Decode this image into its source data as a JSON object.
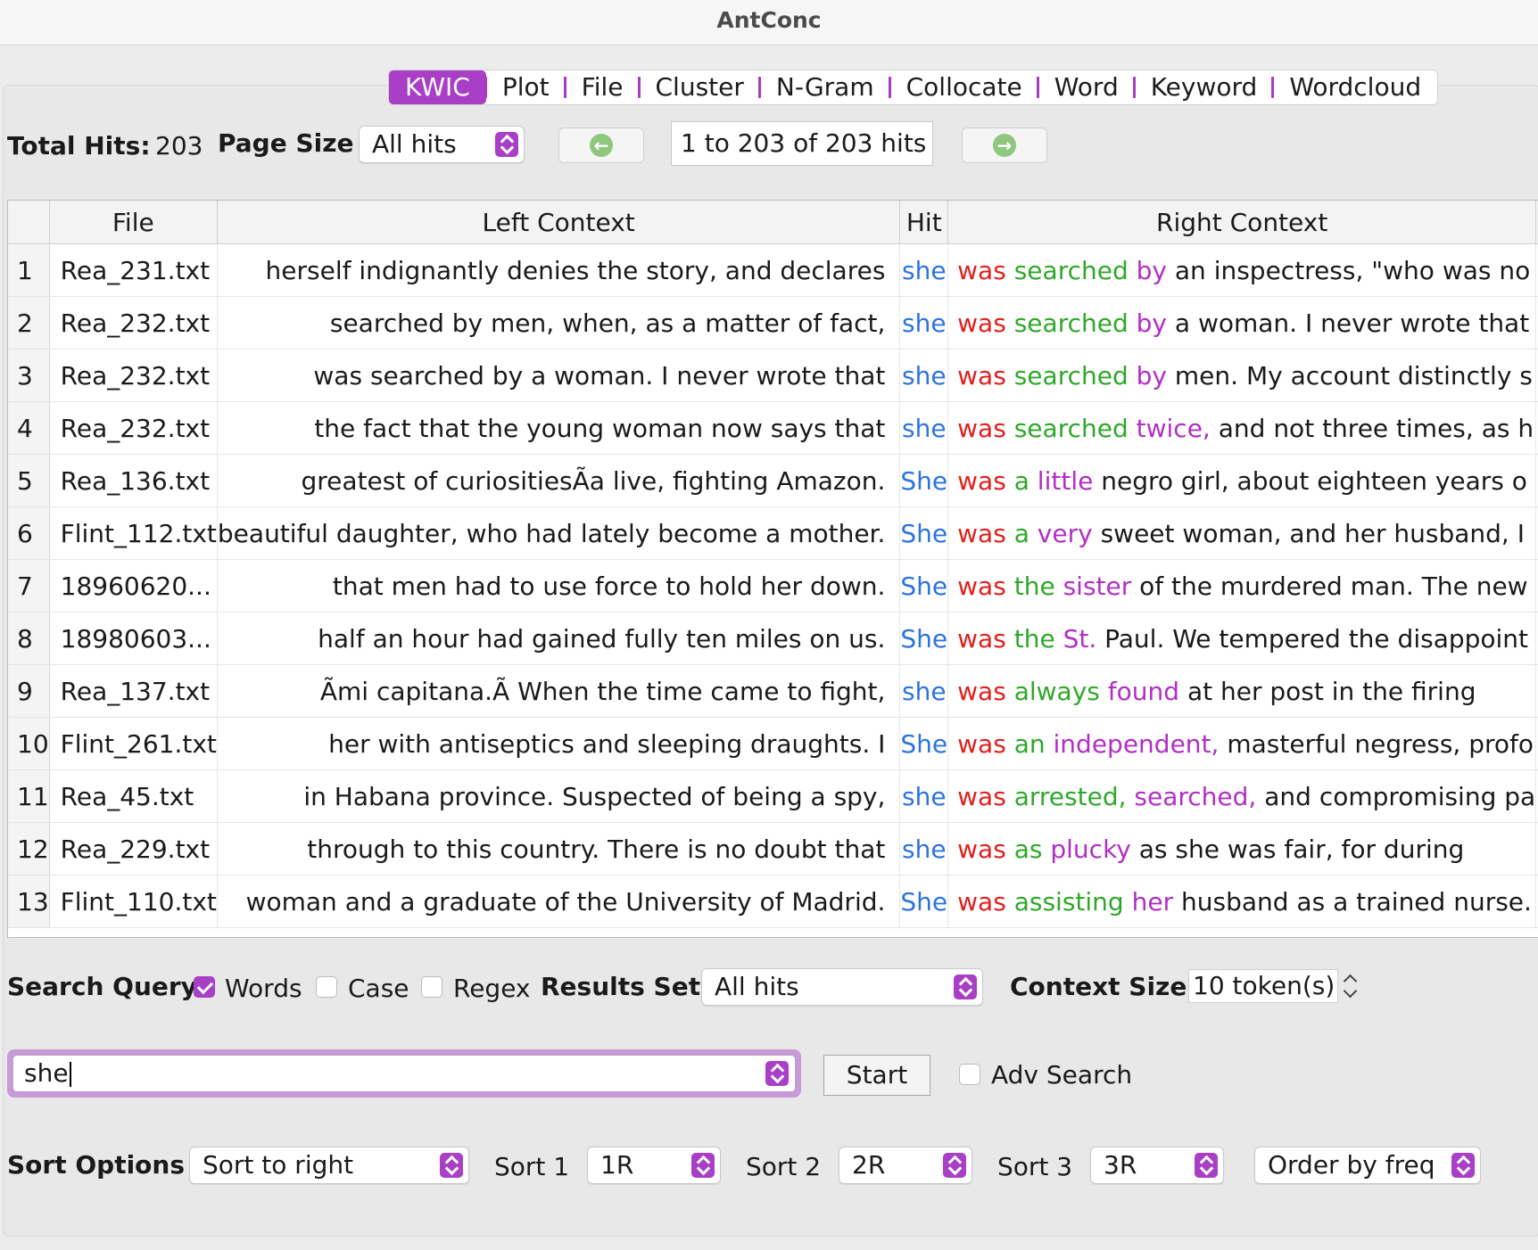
{
  "window": {
    "title": "AntConc"
  },
  "tabs": [
    {
      "label": "KWIC",
      "active": true
    },
    {
      "label": "Plot"
    },
    {
      "label": "File"
    },
    {
      "label": "Cluster"
    },
    {
      "label": "N-Gram"
    },
    {
      "label": "Collocate"
    },
    {
      "label": "Word"
    },
    {
      "label": "Keyword"
    },
    {
      "label": "Wordcloud"
    }
  ],
  "toolbar": {
    "total_hits_label": "Total Hits:",
    "total_hits_value": "203",
    "page_size_label": "Page Size",
    "page_size_value": "All hits",
    "prev_icon": "arrow-left-circle-icon",
    "next_icon": "arrow-right-circle-icon",
    "page_range": "1 to 203 of 203 hits"
  },
  "table": {
    "columns": [
      "",
      "File",
      "Left Context",
      "Hit",
      "Right Context"
    ],
    "rows": [
      {
        "n": "1",
        "file": "Rea_231.txt",
        "left": "herself indignantly denies the story, and declares",
        "hit": "she",
        "r1": "was",
        "r2": "searched",
        "r3": "by",
        "rest": "an inspectress, \"who was no"
      },
      {
        "n": "2",
        "file": "Rea_232.txt",
        "left": "searched by men, when, as a matter of fact,",
        "hit": "she",
        "r1": "was",
        "r2": "searched",
        "r3": "by",
        "rest": "a woman. I never wrote that"
      },
      {
        "n": "3",
        "file": "Rea_232.txt",
        "left": "was searched by a woman. I never wrote that",
        "hit": "she",
        "r1": "was",
        "r2": "searched",
        "r3": "by",
        "rest": "men. My account distinctly s"
      },
      {
        "n": "4",
        "file": "Rea_232.txt",
        "left": "the fact that the young woman now says that",
        "hit": "she",
        "r1": "was",
        "r2": "searched",
        "r3": "twice,",
        "rest": "and not three times, as h"
      },
      {
        "n": "5",
        "file": "Rea_136.txt",
        "left": "greatest of curiositiesÃa live, fighting Amazon.",
        "hit": "She",
        "r1": "was",
        "r2": "a",
        "r3": "little",
        "rest": "negro girl, about eighteen years o"
      },
      {
        "n": "6",
        "file": "Flint_112.txt",
        "left": "beautiful daughter, who had lately become a mother.",
        "hit": "She",
        "r1": "was",
        "r2": "a",
        "r3": "very",
        "rest": "sweet woman, and her husband, I"
      },
      {
        "n": "7",
        "file": "18960620...",
        "left": "that men had to use force to hold her down.",
        "hit": "She",
        "r1": "was",
        "r2": "the",
        "r3": "sister",
        "rest": "of the murdered man. The new"
      },
      {
        "n": "8",
        "file": "18980603...",
        "left": "half an hour had gained fully ten miles on us.",
        "hit": "She",
        "r1": "was",
        "r2": "the",
        "r3": "St.",
        "rest": "Paul. We tempered the disappoint"
      },
      {
        "n": "9",
        "file": "Rea_137.txt",
        "left": "Ãmi capitana.Ã When the time came to fight,",
        "hit": "she",
        "r1": "was",
        "r2": "always",
        "r3": "found",
        "rest": "at her post in the firing"
      },
      {
        "n": "10",
        "file": "Flint_261.txt",
        "left": "her with antiseptics and sleeping draughts. I",
        "hit": "She",
        "r1": "was",
        "r2": "an",
        "r3": "independent,",
        "rest": "masterful negress, profo"
      },
      {
        "n": "11",
        "file": "Rea_45.txt",
        "left": "in Habana province. Suspected of being a spy,",
        "hit": "she",
        "r1": "was",
        "r2": "arrested,",
        "r3": "searched,",
        "rest": "and compromising pa"
      },
      {
        "n": "12",
        "file": "Rea_229.txt",
        "left": "through to this country. There is no doubt that",
        "hit": "she",
        "r1": "was",
        "r2": "as",
        "r3": "plucky",
        "rest": "as she was fair, for during"
      },
      {
        "n": "13",
        "file": "Flint_110.txt",
        "left": "woman and a graduate of the University of Madrid.",
        "hit": "She",
        "r1": "was",
        "r2": "assisting",
        "r3": "her",
        "rest": "husband as a trained nurse."
      }
    ]
  },
  "search": {
    "query_label": "Search Query",
    "words_label": "Words",
    "words_checked": true,
    "case_label": "Case",
    "case_checked": false,
    "regex_label": "Regex",
    "regex_checked": false,
    "results_set_label": "Results Set",
    "results_set_value": "All hits",
    "context_size_label": "Context Size",
    "context_size_value": "10 token(s)",
    "query_value": "she",
    "start_label": "Start",
    "adv_search_label": "Adv Search",
    "adv_search_checked": false
  },
  "sort": {
    "options_label": "Sort Options",
    "mode_value": "Sort to right",
    "sort1_label": "Sort 1",
    "sort1_value": "1R",
    "sort2_label": "Sort 2",
    "sort2_value": "2R",
    "sort3_label": "Sort 3",
    "sort3_value": "3R",
    "order_value": "Order by freq"
  },
  "colors": {
    "accent": "#a83fc6",
    "hit": "#2d73e0",
    "r1": "#e0201e",
    "r2": "#2fa82a",
    "r3": "#b22fc5"
  }
}
